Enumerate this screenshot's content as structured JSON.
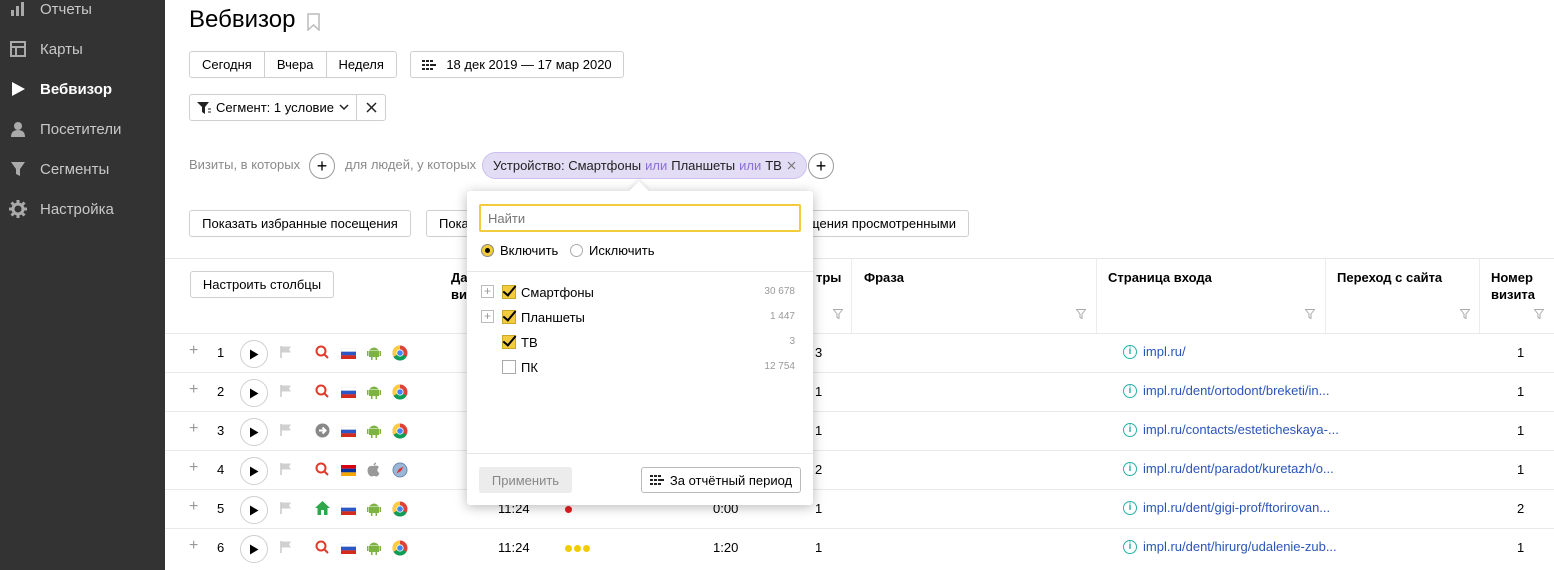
{
  "sidebar": {
    "items": [
      {
        "label": "Отчеты",
        "icon": "bar-chart-icon"
      },
      {
        "label": "Карты",
        "icon": "map-icon"
      },
      {
        "label": "Вебвизор",
        "icon": "play-icon"
      },
      {
        "label": "Посетители",
        "icon": "person-icon"
      },
      {
        "label": "Сегменты",
        "icon": "funnel-icon"
      },
      {
        "label": "Настройка",
        "icon": "gear-icon"
      }
    ]
  },
  "header": {
    "title": "Вебвизор",
    "period_buttons": [
      "Сегодня",
      "Вчера",
      "Неделя"
    ],
    "date_range": "18 дек 2019 — 17 мар 2020",
    "segment_label": "Сегмент: 1 условие"
  },
  "condition": {
    "visits_label": "Визиты, в которых",
    "people_label": "для людей, у которых",
    "chip": {
      "prefix": "Устройство: Смартфоны",
      "or1": "или",
      "mid": "Планшеты",
      "or2": "или",
      "last": "ТВ"
    }
  },
  "toolbar": {
    "show_favorites": "Показать избранные посещения",
    "partial_left": "Пока",
    "partial_right": "щения просмотренными"
  },
  "table": {
    "configure_columns": "Настроить столбцы",
    "headers": {
      "date_partial_1": "Да",
      "date_partial_2": "ви",
      "views_partial": "тры",
      "phrase": "Фраза",
      "entry_page": "Страница входа",
      "referrer": "Переход с сайта",
      "visit_number_1": "Номер",
      "visit_number_2": "визита"
    },
    "rows": [
      {
        "num": "1",
        "time": "",
        "dur": "",
        "views": "3",
        "link": "impl.ru/",
        "visit": "1"
      },
      {
        "num": "2",
        "time": "",
        "dur": "",
        "views": "1",
        "link": "impl.ru/dent/ortodont/breketi/in...",
        "visit": "1"
      },
      {
        "num": "3",
        "time": "",
        "dur": "",
        "views": "1",
        "link": "impl.ru/contacts/esteticheskaya-...",
        "visit": "1"
      },
      {
        "num": "4",
        "time": "",
        "dur": "",
        "views": "2",
        "link": "impl.ru/dent/paradot/kuretazh/o...",
        "visit": "1"
      },
      {
        "num": "5",
        "time": "11:24",
        "dur": "0:00",
        "views": "1",
        "link": "impl.ru/dent/gigi-prof/ftorirovan...",
        "visit": "2"
      },
      {
        "num": "6",
        "time": "11:24",
        "dur": "1:20",
        "views": "1",
        "link": "impl.ru/dent/hirurg/udalenie-zub...",
        "visit": "1"
      }
    ]
  },
  "popup": {
    "search_placeholder": "Найти",
    "include": "Включить",
    "exclude": "Исключить",
    "options": [
      {
        "label": "Смартфоны",
        "count": "30 678",
        "checked": true,
        "expandable": true
      },
      {
        "label": "Планшеты",
        "count": "1 447",
        "checked": true,
        "expandable": true
      },
      {
        "label": "ТВ",
        "count": "3",
        "checked": true,
        "expandable": false
      },
      {
        "label": "ПК",
        "count": "12 754",
        "checked": false,
        "expandable": false
      }
    ],
    "apply": "Применить",
    "period": "За отчётный период"
  },
  "colors": {
    "sidebar_bg": "#333333",
    "accent_yellow": "#f2cc3d",
    "chip_bg": "#e2dcf5",
    "link": "#2a55b8"
  }
}
